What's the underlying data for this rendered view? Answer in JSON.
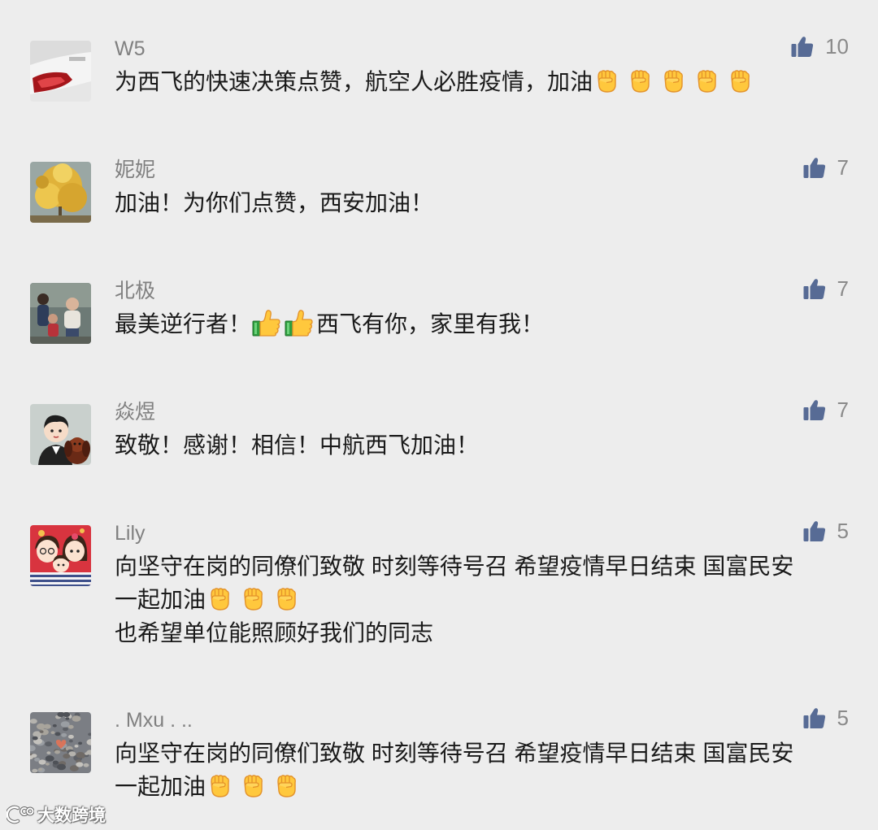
{
  "colors": {
    "background": "#ededed",
    "name": "#808080",
    "text": "#1a1a1a",
    "like_icon": "#576b95",
    "like_count": "#8a8a8a"
  },
  "icons": {
    "like": "thumbs-up-icon"
  },
  "comments": [
    {
      "name": "W5",
      "likes": "10",
      "avatar_icon": "car-avatar",
      "lines": [
        [
          {
            "text": "为西飞的快速决策点赞，航空人必胜疫情，加油"
          },
          {
            "emoji": "raised-fist"
          },
          {
            "emoji": "raised-fist"
          },
          {
            "emoji": "raised-fist"
          },
          {
            "emoji": "raised-fist"
          },
          {
            "emoji": "raised-fist"
          }
        ]
      ]
    },
    {
      "name": "妮妮",
      "likes": "7",
      "avatar_icon": "ginkgo-avatar",
      "lines": [
        [
          {
            "text": "加油！为你们点赞，西安加油！"
          }
        ]
      ]
    },
    {
      "name": "北极",
      "likes": "7",
      "avatar_icon": "people-photo-avatar",
      "lines": [
        [
          {
            "text": "最美逆行者！"
          },
          {
            "emoji": "thumbs-up"
          },
          {
            "emoji": "thumbs-up"
          },
          {
            "text": "西飞有你，家里有我！"
          }
        ]
      ]
    },
    {
      "name": "焱煜",
      "likes": "7",
      "avatar_icon": "cartoon-man-dog-avatar",
      "lines": [
        [
          {
            "text": "致敬！感谢！相信！中航西飞加油！"
          }
        ]
      ]
    },
    {
      "name": "Lily",
      "likes": "5",
      "avatar_icon": "cartoon-family-avatar",
      "lines": [
        [
          {
            "text": "向坚守在岗的同僚们致敬 时刻等待号召 希望疫情早日结束 国富民安"
          }
        ],
        [
          {
            "text": "一起加油"
          },
          {
            "emoji": "raised-fist"
          },
          {
            "emoji": "raised-fist"
          },
          {
            "emoji": "raised-fist"
          }
        ],
        [
          {
            "text": "也希望单位能照顾好我们的同志"
          }
        ]
      ]
    },
    {
      "name": ". Mxu . ..",
      "likes": "5",
      "avatar_icon": "pebbles-avatar",
      "lines": [
        [
          {
            "text": "向坚守在岗的同僚们致敬 时刻等待号召 希望疫情早日结束 国富民安"
          }
        ],
        [
          {
            "text": "一起加油"
          },
          {
            "emoji": "raised-fist"
          },
          {
            "emoji": "raised-fist"
          },
          {
            "emoji": "raised-fist"
          }
        ]
      ]
    }
  ],
  "watermark": {
    "text": "大数跨境",
    "logo_icon": "watermark-logo-icon"
  }
}
